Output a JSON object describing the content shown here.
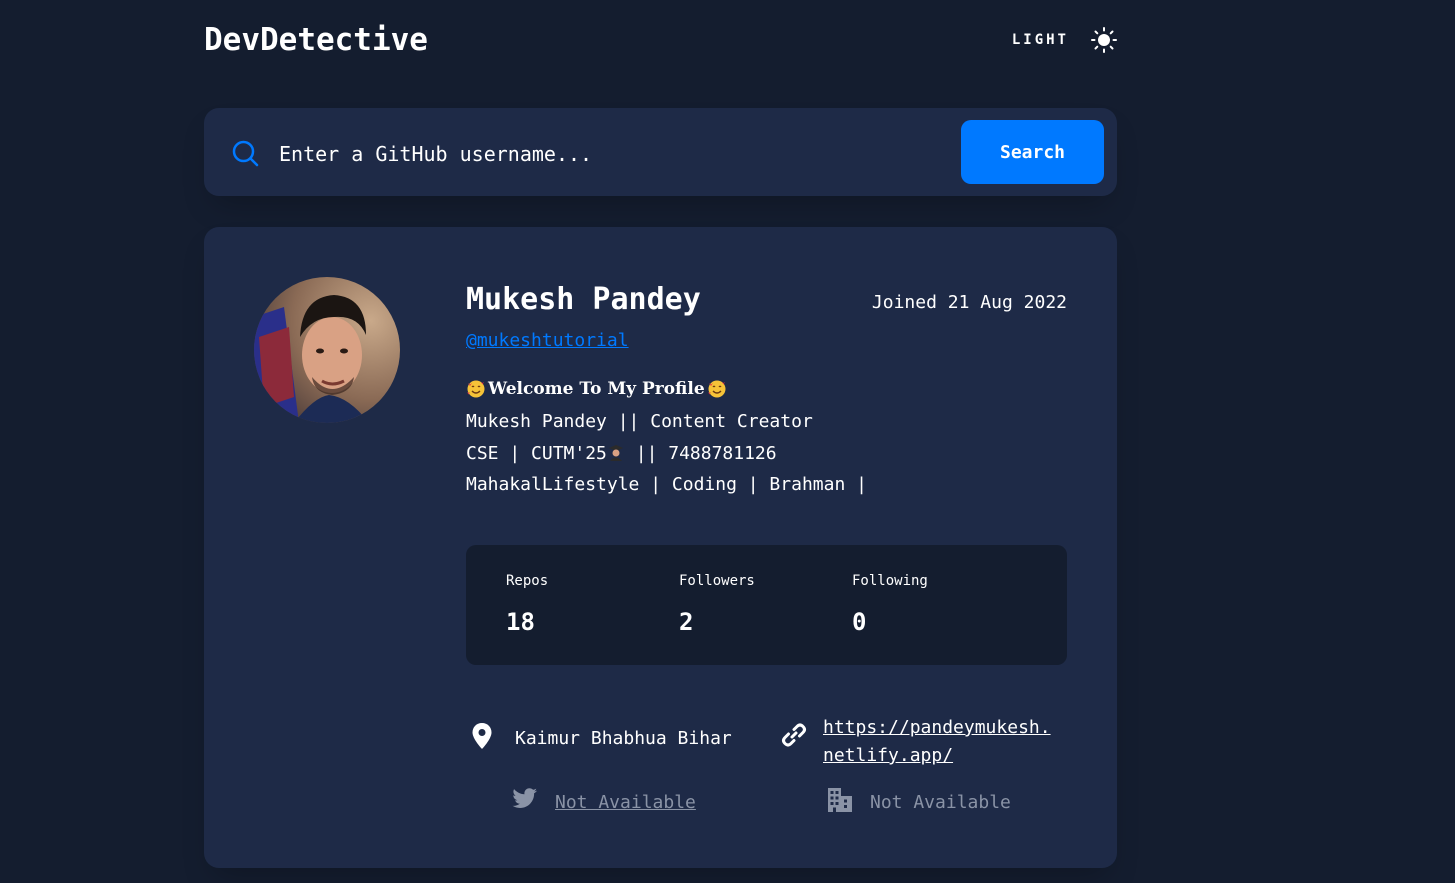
{
  "header": {
    "logo": "DevDetective",
    "mode_label": "LIGHT",
    "mode_icon": "sun-icon"
  },
  "search": {
    "icon": "search-icon",
    "placeholder": "Enter a GitHub username...",
    "button_label": "Search"
  },
  "profile": {
    "avatar": "avatar",
    "name": "Mukesh Pandey",
    "joined": "Joined 21 Aug 2022",
    "login": "@mukeshtutorial",
    "bio_title": "Welcome To My Profile",
    "bio_line1": "Mukesh Pandey || Content Creator",
    "bio_line2_a": "CSE | CUTM'25",
    "bio_line2_b": " || 7488781126",
    "bio_line3": "MahakalLifestyle | Coding | Brahman |"
  },
  "stats": [
    {
      "label": "Repos",
      "value": "18"
    },
    {
      "label": "Followers",
      "value": "2"
    },
    {
      "label": "Following",
      "value": "0"
    }
  ],
  "links": {
    "location": {
      "icon": "location-pin-icon",
      "text": "Kaimur Bhabhua Bihar"
    },
    "website": {
      "icon": "link-icon",
      "text": "https://pandeymukesh.\nnetlify.app/"
    },
    "twitter": {
      "icon": "twitter-icon",
      "text": "Not Available"
    },
    "company": {
      "icon": "building-icon",
      "text": "Not Available"
    }
  },
  "colors": {
    "background": "#141d2f",
    "card": "#1e2a47",
    "accent": "#0079ff",
    "muted": "#8a93a6"
  }
}
